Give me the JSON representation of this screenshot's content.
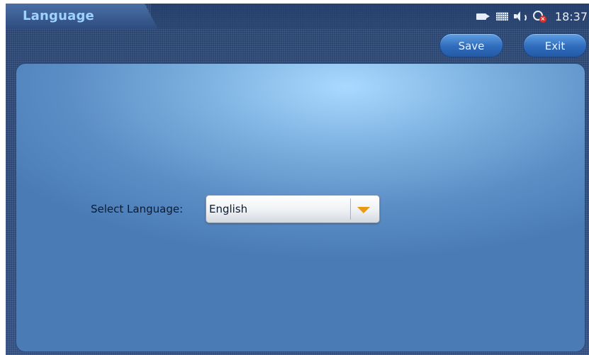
{
  "header": {
    "title": "Language",
    "clock": "18:37"
  },
  "status_icons": [
    "camera-icon",
    "keyboard-icon",
    "speaker-icon",
    "network-disconnected-icon"
  ],
  "toolbar": {
    "save_label": "Save",
    "exit_label": "Exit"
  },
  "form": {
    "language_label": "Select Language:",
    "language_selected": "English"
  },
  "colors": {
    "title_text": "#9fd3ff",
    "button_blue": "#2f6cbc",
    "dropdown_arrow": "#e79a12",
    "network_error": "#d8302a"
  }
}
